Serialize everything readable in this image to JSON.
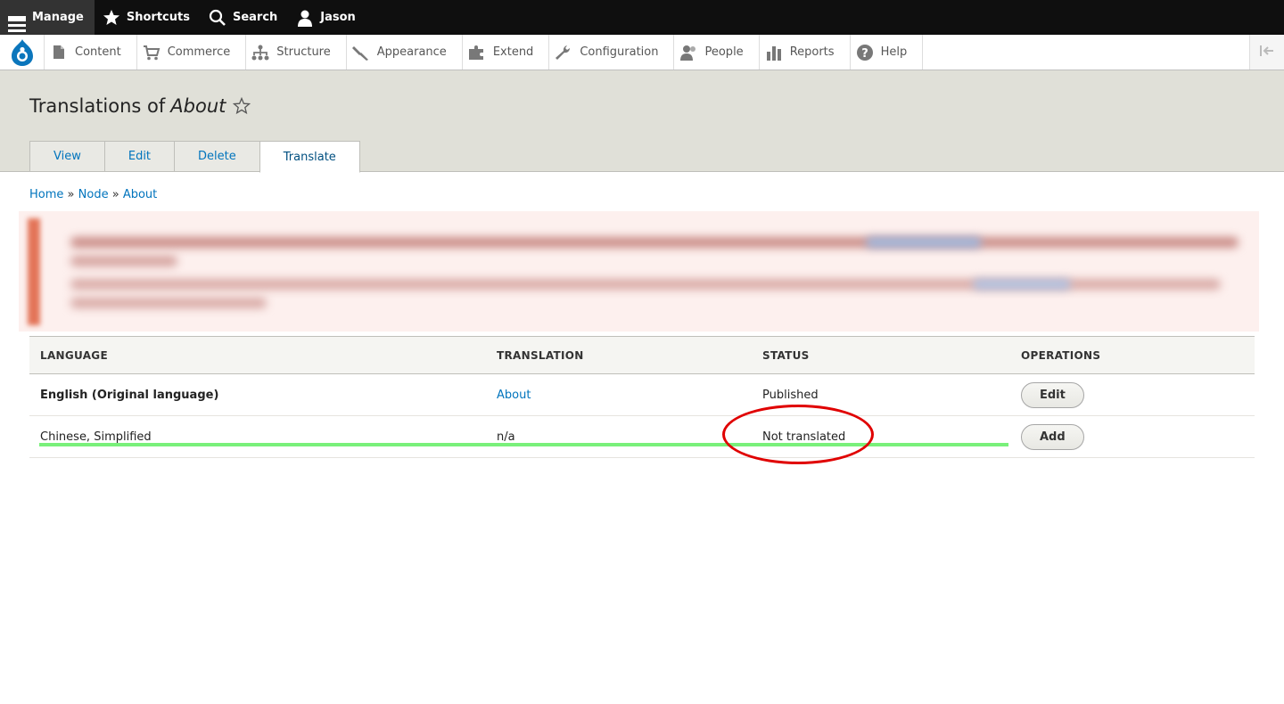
{
  "toolbar": {
    "manage": "Manage",
    "shortcuts": "Shortcuts",
    "search": "Search",
    "user": "Jason"
  },
  "admin_menu": {
    "items": [
      {
        "label": "Content",
        "icon": "file-icon"
      },
      {
        "label": "Commerce",
        "icon": "cart-icon"
      },
      {
        "label": "Structure",
        "icon": "sitemap-icon"
      },
      {
        "label": "Appearance",
        "icon": "brush-icon"
      },
      {
        "label": "Extend",
        "icon": "puzzle-icon"
      },
      {
        "label": "Configuration",
        "icon": "wrench-icon"
      },
      {
        "label": "People",
        "icon": "people-icon"
      },
      {
        "label": "Reports",
        "icon": "bar-chart-icon"
      },
      {
        "label": "Help",
        "icon": "help-icon"
      }
    ]
  },
  "page": {
    "title_prefix": "Translations of",
    "title_node": "About"
  },
  "tabs": [
    {
      "label": "View"
    },
    {
      "label": "Edit"
    },
    {
      "label": "Delete"
    },
    {
      "label": "Translate",
      "active": true
    }
  ],
  "breadcrumb": {
    "home": "Home",
    "sep": "»",
    "node": "Node",
    "current": "About"
  },
  "table": {
    "headers": [
      "LANGUAGE",
      "TRANSLATION",
      "STATUS",
      "OPERATIONS"
    ],
    "rows": [
      {
        "language": "English (Original language)",
        "translation": "About",
        "status": "Published",
        "operation": "Edit"
      },
      {
        "language": "Chinese, Simplified",
        "translation": "n/a",
        "status": "Not translated",
        "operation": "Add"
      }
    ]
  },
  "colors": {
    "link": "#0074bd",
    "toolbar_bg": "#0f0f0f",
    "header_bg": "#e0e0d8",
    "annotation_red": "#e00000",
    "annotation_green": "#79f07a"
  }
}
